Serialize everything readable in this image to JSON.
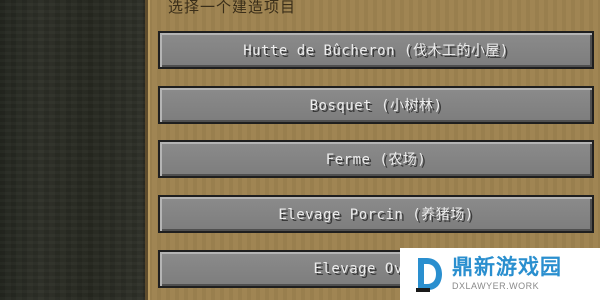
{
  "panel": {
    "title": "选择一个建造项目"
  },
  "buttons": [
    {
      "label": "Hutte de Bûcheron (伐木工的小屋)"
    },
    {
      "label": "Bosquet (小树林)"
    },
    {
      "label": "Ferme (农场)"
    },
    {
      "label": "Elevage Porcin (养猪场)"
    },
    {
      "label": "Elevage Ovin ("
    }
  ],
  "watermark": {
    "name": "鼎新游戏园",
    "url": "DXLAWYER.WORK",
    "icon": "d-logo-icon",
    "color": "#2a8fcf"
  },
  "colors": {
    "panel": "#9e8350",
    "button": "#858585",
    "button_text": "#ececec",
    "background": "#2c2a22"
  }
}
